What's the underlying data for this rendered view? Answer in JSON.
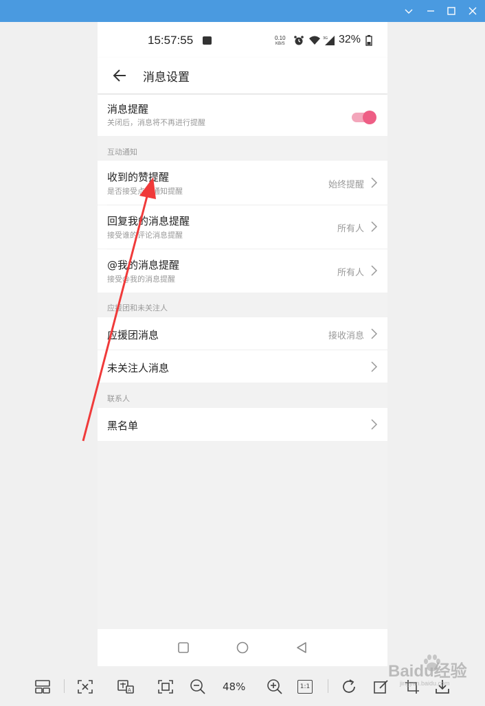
{
  "status_bar": {
    "time": "15:57:55",
    "net_speed_value": "0.10",
    "net_speed_unit": "KB/S",
    "battery": "32%"
  },
  "header": {
    "title": "消息设置",
    "back_icon": "arrow-left-icon"
  },
  "master_toggle": {
    "title": "消息提醒",
    "subtitle": "关闭后，消息将不再进行提醒",
    "enabled": true,
    "accent": "#ee5e85"
  },
  "sections": [
    {
      "label": "互动通知",
      "items": [
        {
          "title": "收到的赞提醒",
          "subtitle": "是否接受点赞通知提醒",
          "value": "始终提醒"
        },
        {
          "title": "回复我的消息提醒",
          "subtitle": "接受谁的评论消息提醒",
          "value": "所有人"
        },
        {
          "title": "@我的消息提醒",
          "subtitle": "接受@我的消息提醒",
          "value": "所有人"
        }
      ]
    },
    {
      "label": "应援团和未关注人",
      "items": [
        {
          "title": "应援团消息",
          "value": "接收消息"
        },
        {
          "title": "未关注人消息",
          "value": ""
        }
      ]
    },
    {
      "label": "联系人",
      "items": [
        {
          "title": "黑名单",
          "value": ""
        }
      ]
    }
  ],
  "viewer_toolbar": {
    "zoom_level": "48%",
    "actual_size_label": "1:1",
    "watermark": "Baidu经验",
    "watermark_sub": "jingyan.baidu.com"
  }
}
